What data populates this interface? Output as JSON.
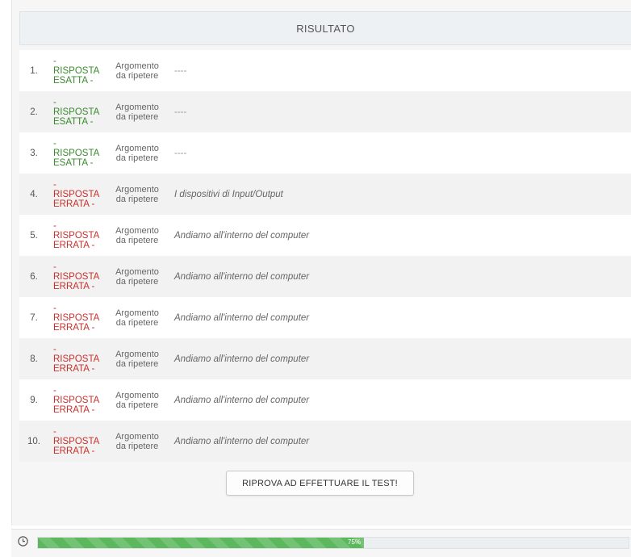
{
  "header": {
    "title": "RISULTATO"
  },
  "arg_label_line1": "Argomento",
  "arg_label_line2": "da ripetere",
  "rows": [
    {
      "n": "1.",
      "dash": "-",
      "status1": "RISPOSTA",
      "status2": "ESATTA -",
      "kind": "ok",
      "topic": "----"
    },
    {
      "n": "2.",
      "dash": "-",
      "status1": "RISPOSTA",
      "status2": "ESATTA -",
      "kind": "ok",
      "topic": "----"
    },
    {
      "n": "3.",
      "dash": "-",
      "status1": "RISPOSTA",
      "status2": "ESATTA -",
      "kind": "ok",
      "topic": "----"
    },
    {
      "n": "4.",
      "dash": "-",
      "status1": "RISPOSTA",
      "status2": "ERRATA -",
      "kind": "err",
      "topic": "I dispositivi di Input/Output"
    },
    {
      "n": "5.",
      "dash": "-",
      "status1": "RISPOSTA",
      "status2": "ERRATA -",
      "kind": "err",
      "topic": "Andiamo all'interno del computer"
    },
    {
      "n": "6.",
      "dash": "-",
      "status1": "RISPOSTA",
      "status2": "ERRATA -",
      "kind": "err",
      "topic": "Andiamo all'interno del computer"
    },
    {
      "n": "7.",
      "dash": "-",
      "status1": "RISPOSTA",
      "status2": "ERRATA -",
      "kind": "err",
      "topic": "Andiamo all'interno del computer"
    },
    {
      "n": "8.",
      "dash": "-",
      "status1": "RISPOSTA",
      "status2": "ERRATA -",
      "kind": "err",
      "topic": "Andiamo all'interno del computer"
    },
    {
      "n": "9.",
      "dash": "-",
      "status1": "RISPOSTA",
      "status2": "ERRATA -",
      "kind": "err",
      "topic": "Andiamo all'interno del computer"
    },
    {
      "n": "10.",
      "dash": "-",
      "status1": "RISPOSTA",
      "status2": "ERRATA -",
      "kind": "err",
      "topic": "Andiamo all'interno del computer"
    }
  ],
  "retry_button": {
    "label": "RIPROVA AD EFFETTUARE IL TEST!"
  },
  "progress": {
    "value": 0.75,
    "label": "75%"
  },
  "colors": {
    "correct": "#3a8a2e",
    "wrong": "#c9302c",
    "progress": "#5cb85c"
  },
  "icons": {
    "timer": "clock-icon"
  }
}
